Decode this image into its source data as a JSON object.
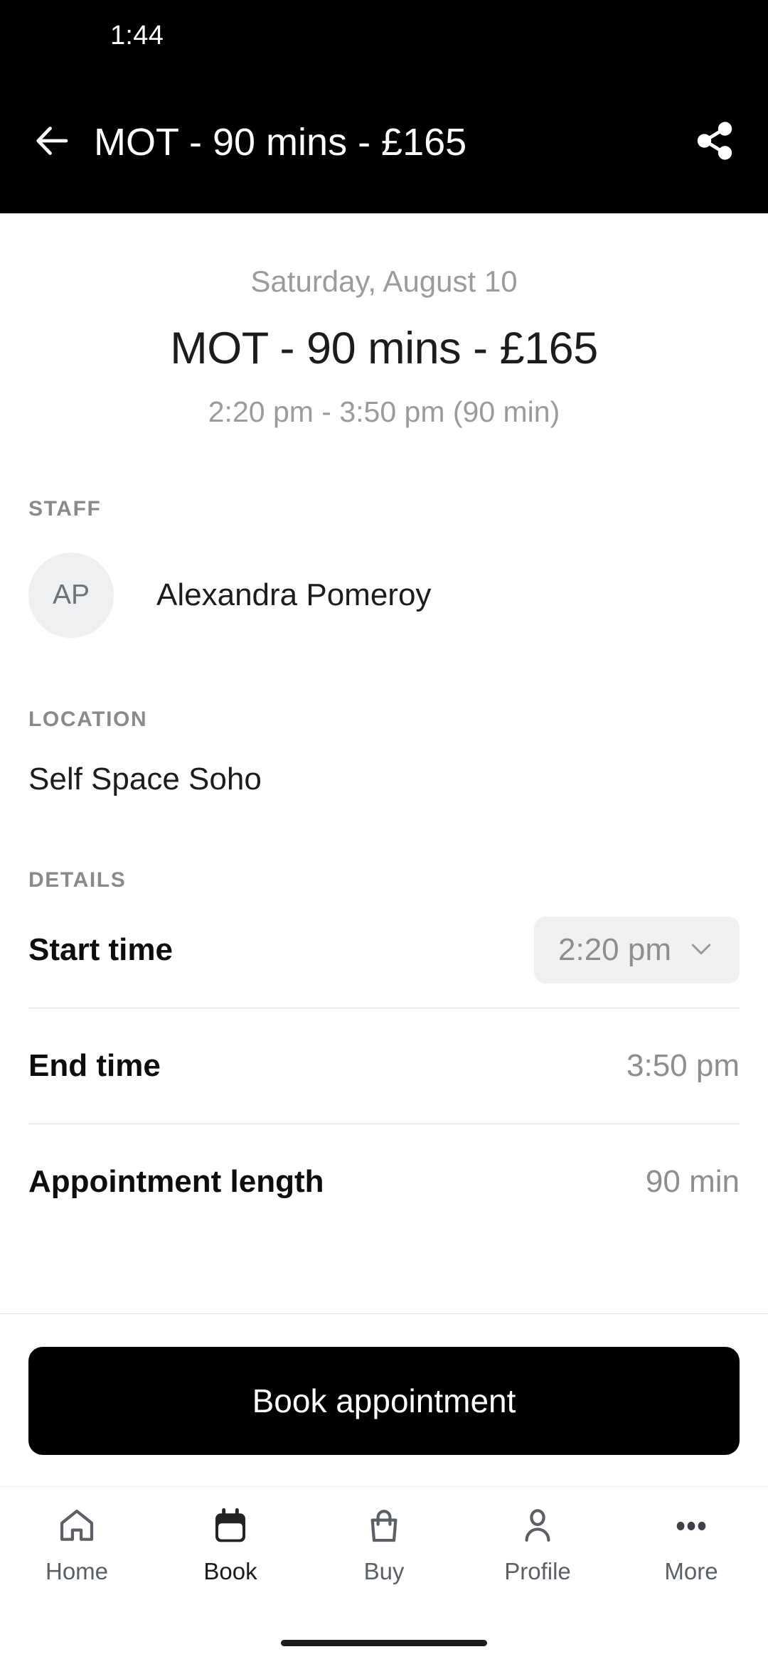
{
  "status_bar": {
    "time": "1:44"
  },
  "app_bar": {
    "title": "MOT - 90 mins - £165",
    "back_icon": "arrow-left-icon",
    "share_icon": "share-icon"
  },
  "hero": {
    "date": "Saturday, August 10",
    "title": "MOT - 90 mins - £165",
    "time_range": "2:20 pm - 3:50 pm (90 min)"
  },
  "staff": {
    "label": "STAFF",
    "avatar_initials": "AP",
    "name": "Alexandra Pomeroy"
  },
  "location": {
    "label": "LOCATION",
    "value": "Self Space Soho"
  },
  "details": {
    "label": "DETAILS",
    "rows": [
      {
        "key": "Start time",
        "value": "2:20 pm",
        "type": "dropdown"
      },
      {
        "key": "End time",
        "value": "3:50 pm",
        "type": "text"
      },
      {
        "key": "Appointment length",
        "value": "90 min",
        "type": "text"
      }
    ]
  },
  "footer": {
    "cta_label": "Book appointment"
  },
  "bottom_nav": {
    "items": [
      {
        "label": "Home",
        "icon": "home-icon",
        "active": false
      },
      {
        "label": "Book",
        "icon": "calendar-icon",
        "active": true
      },
      {
        "label": "Buy",
        "icon": "shopping-bag-icon",
        "active": false
      },
      {
        "label": "Profile",
        "icon": "person-icon",
        "active": false
      },
      {
        "label": "More",
        "icon": "ellipsis-icon",
        "active": false
      }
    ]
  },
  "colors": {
    "app_bar_bg": "#000000",
    "page_bg": "#ffffff",
    "primary_text": "#1c1c1c",
    "muted_text": "#9b9b9b",
    "label_text": "#8a8a8a",
    "pill_bg": "#eff1f3",
    "avatar_bg": "#eef0f2",
    "cta_bg": "#000000",
    "divider": "#e2e2e2"
  }
}
